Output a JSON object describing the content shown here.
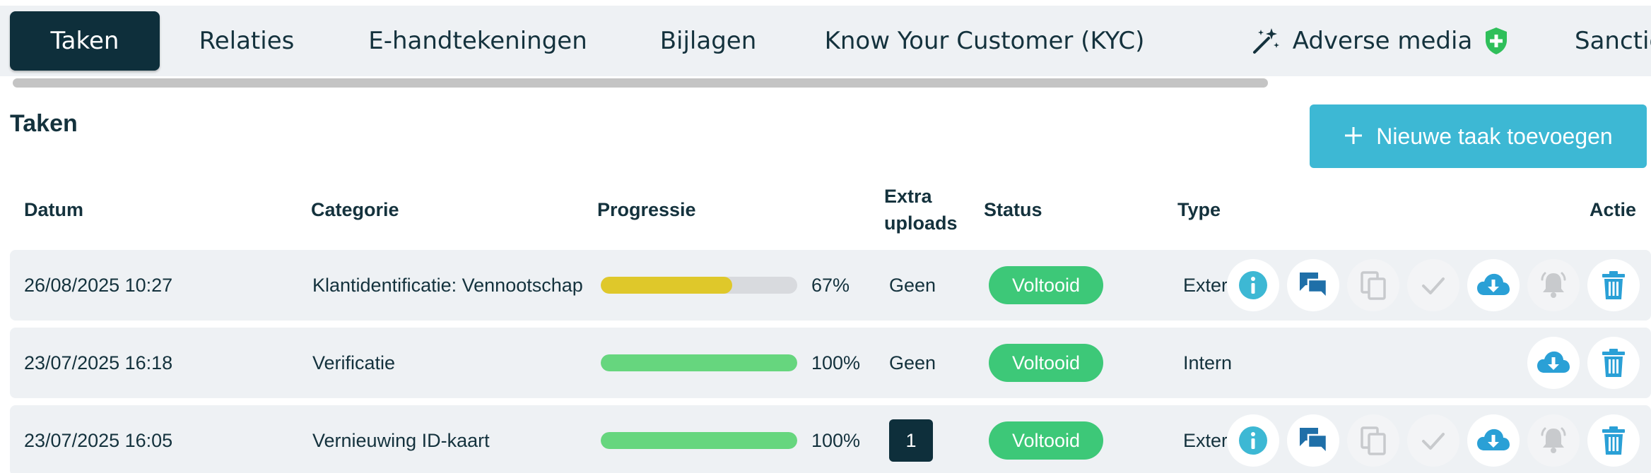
{
  "tabs": [
    {
      "label": "Taken",
      "active": true
    },
    {
      "label": "Relaties",
      "active": false
    },
    {
      "label": "E-handtekeningen",
      "active": false
    },
    {
      "label": "Bijlagen",
      "active": false
    },
    {
      "label": "Know Your Customer (KYC)",
      "active": false
    },
    {
      "label": "Adverse media",
      "active": false,
      "icon": "magic-wand-icon",
      "badge_icon": "shield-plus-icon"
    },
    {
      "label": "Sanctie",
      "active": false
    }
  ],
  "page": {
    "title": "Taken",
    "add_button_label": "Nieuwe taak toevoegen",
    "add_button_icon": "plus-icon"
  },
  "table": {
    "headers": {
      "datum": "Datum",
      "categorie": "Categorie",
      "progressie": "Progressie",
      "extra_line1": "Extra",
      "extra_line2": "uploads",
      "status": "Status",
      "type": "Type",
      "actie": "Actie"
    },
    "rows": [
      {
        "datum": "26/08/2025 10:27",
        "categorie": "Klantidentificatie: Vennootschap",
        "progress": 67,
        "progress_label": "67%",
        "progress_color": "#dfc82a",
        "extra_uploads": "Geen",
        "status": "Voltooid",
        "type": "Extern",
        "actions": [
          "info-icon",
          "chat-icon",
          "copy-icon",
          "check-icon",
          "download-icon",
          "bell-icon",
          "trash-icon"
        ]
      },
      {
        "datum": "23/07/2025 16:18",
        "categorie": "Verificatie",
        "progress": 100,
        "progress_label": "100%",
        "progress_color": "#66d67e",
        "extra_uploads": "Geen",
        "status": "Voltooid",
        "type": "Intern",
        "actions": [
          "download-icon",
          "trash-icon"
        ]
      },
      {
        "datum": "23/07/2025 16:05",
        "categorie": "Vernieuwing ID-kaart",
        "progress": 100,
        "progress_label": "100%",
        "progress_color": "#66d67e",
        "extra_uploads": "1",
        "status": "Voltooid",
        "type": "Extern",
        "actions": [
          "info-icon",
          "chat-icon",
          "copy-icon",
          "check-icon",
          "download-icon",
          "bell-icon",
          "trash-icon"
        ]
      }
    ]
  },
  "colors": {
    "primary_dark": "#0e2f3b",
    "accent": "#3db8d4",
    "success": "#3dc878",
    "shield": "#2fbf5a"
  }
}
